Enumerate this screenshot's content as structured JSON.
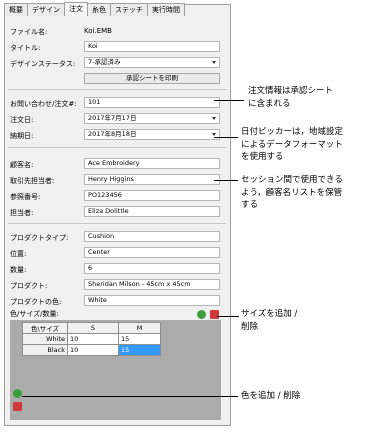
{
  "tabs": [
    "概要",
    "デザイン",
    "注文",
    "糸色",
    "ステッチ",
    "実行時間"
  ],
  "fields": {
    "filename": {
      "label": "ファイル名:",
      "value": "Koi.EMB"
    },
    "title": {
      "label": "タイトル:",
      "value": "Koi"
    },
    "design_status": {
      "label": "デザインステータス:",
      "value": "7-承認済み"
    },
    "print_approval_button": "承認シートを印刷",
    "inquiry": {
      "label": "お問い合わせ/注文#:",
      "value": "101"
    },
    "order_date": {
      "label": "注文日:",
      "value": "2017年7月17日"
    },
    "delivery_date": {
      "label": "納期日:",
      "value": "2017年8月18日"
    },
    "customer_name": {
      "label": "顧客名:",
      "value": "Ace Embroidery"
    },
    "contact": {
      "label": "取引先担当者:",
      "value": "Henry Higgins"
    },
    "reference": {
      "label": "参照番号:",
      "value": "PO123456"
    },
    "rep": {
      "label": "担当者:",
      "value": "Eliza Dolittle"
    },
    "product_type": {
      "label": "プロダクトタイプ:",
      "value": "Cushion"
    },
    "position": {
      "label": "位置:",
      "value": "Center"
    },
    "quantity": {
      "label": "数量:",
      "value": "6"
    },
    "product": {
      "label": "プロダクト:",
      "value": "Sheridan Milson - 45cm x 45cm"
    },
    "product_color": {
      "label": "プロダクトの色:",
      "value": "White"
    },
    "color_size_qty": {
      "label": "色/サイズ/数量:"
    }
  },
  "grid": {
    "corner": "色\\サイズ",
    "columns": [
      "S",
      "M"
    ],
    "rows": [
      {
        "name": "White",
        "values": [
          "10",
          "15"
        ]
      },
      {
        "name": "Black",
        "values": [
          "10",
          "15"
        ]
      }
    ]
  },
  "annotations": {
    "order_info": [
      "注文情報は承認シート",
      "に含まれる"
    ],
    "date_picker": [
      "日付ピッカーは，地域設定",
      "によるデータフォーマット",
      "を使用する"
    ],
    "customer_list": [
      "セッション間で使用できる",
      "よう，顧客名リストを保管",
      "する"
    ],
    "size_add": [
      "サイズを追加 /",
      "削除"
    ],
    "color_add": [
      "色を追加 / 削除"
    ]
  },
  "icons": [
    "add-size-icon",
    "delete-size-icon",
    "add-color-icon",
    "delete-color-icon",
    "dropdown-arrow-icon"
  ],
  "colors": {
    "selection": "#3399ff",
    "add": "#3c9f3c",
    "delete": "#d23a3a"
  }
}
